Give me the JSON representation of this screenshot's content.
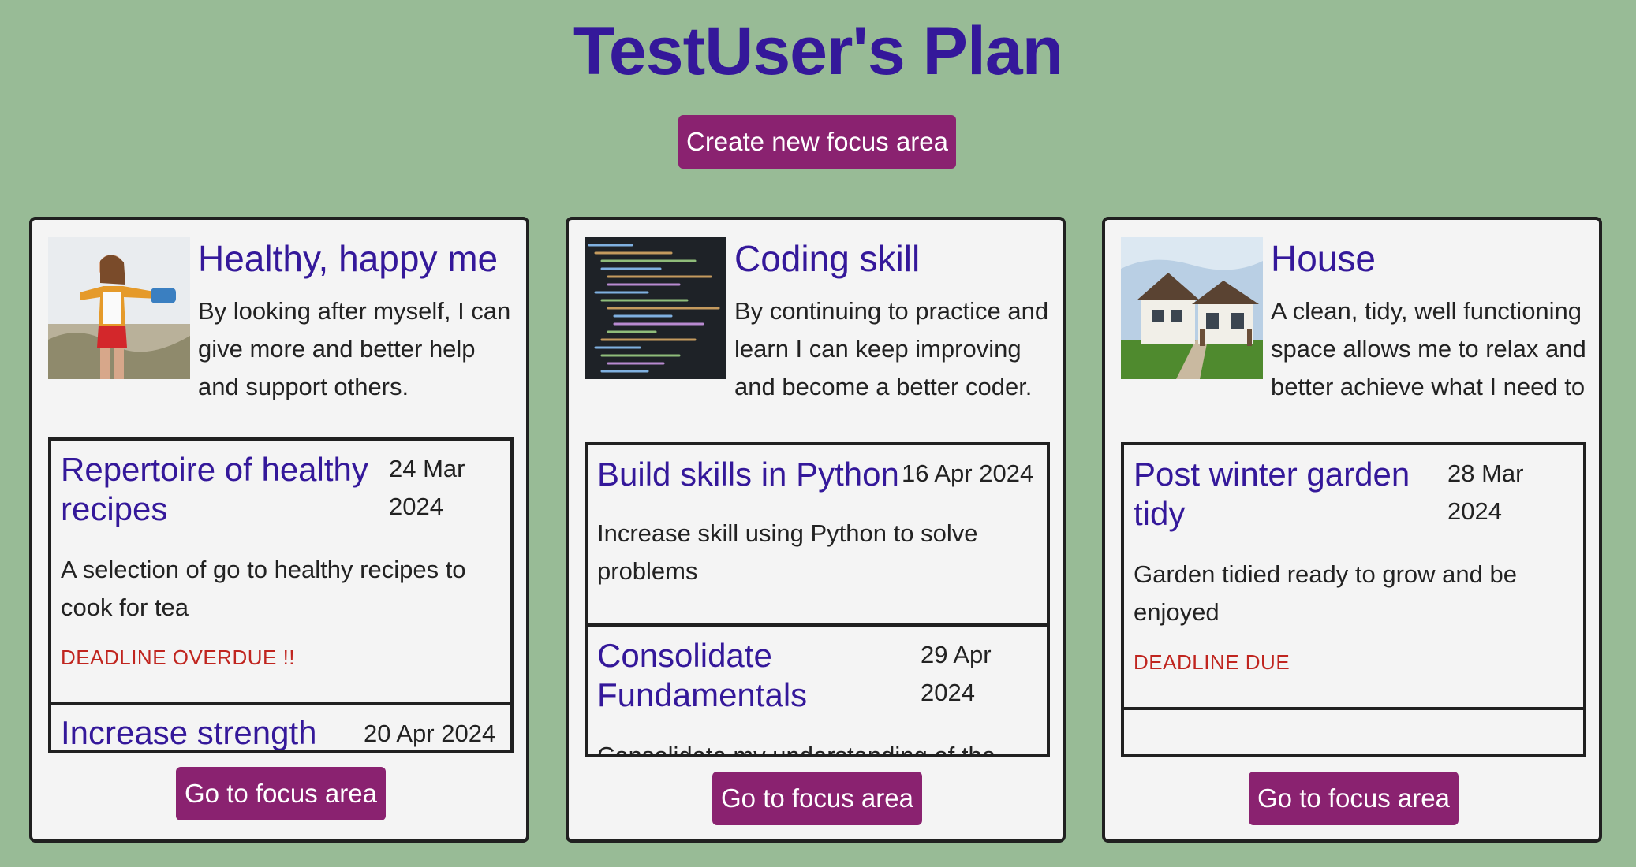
{
  "header": {
    "title": "TestUser's Plan",
    "create_button": "Create new focus area"
  },
  "colors": {
    "background": "#98bb96",
    "title": "#34189a",
    "button": "#8a2270",
    "overdue": "#c0251f"
  },
  "focus_areas": [
    {
      "name": "Healthy, happy me",
      "image_icon": "woman-outdoors-photo",
      "description": "By looking after myself, I can give more and better help and support others.",
      "goals": [
        {
          "title": "Repertoire of healthy recipes",
          "date": "24 Mar 2024",
          "description": "A selection of go to healthy recipes to cook for tea",
          "status": "DEADLINE OVERDUE !!"
        },
        {
          "title": "Increase strength",
          "date": "20 Apr 2024"
        }
      ],
      "button": "Go to focus area"
    },
    {
      "name": "Coding skill",
      "image_icon": "code-editor-photo",
      "description": "By continuing to practice and learn I can keep improving and become a better coder.",
      "goals": [
        {
          "title": "Build skills in Python",
          "date": "16 Apr 2024",
          "description": "Increase skill using Python to solve problems"
        },
        {
          "title": "Consolidate Fundamentals",
          "date": "29 Apr 2024",
          "description": "Consolidate my understanding of the"
        }
      ],
      "button": "Go to focus area"
    },
    {
      "name": "House",
      "image_icon": "house-photo",
      "description": "A clean, tidy, well functioning space allows me to relax and better achieve what I need to do",
      "goals": [
        {
          "title": "Post winter garden tidy",
          "date": "28 Mar 2024",
          "description": "Garden tidied ready to grow and be enjoyed",
          "status": "DEADLINE DUE"
        }
      ],
      "button": "Go to focus area"
    }
  ]
}
